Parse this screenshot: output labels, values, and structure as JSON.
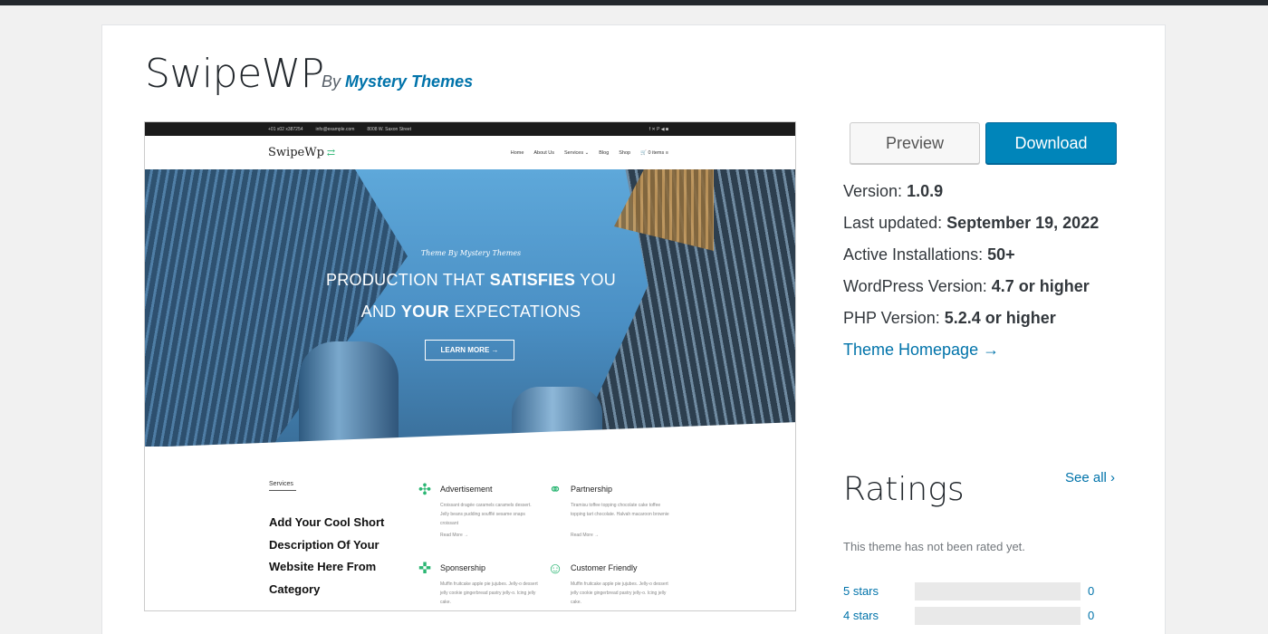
{
  "theme": {
    "name": "SwipeWP",
    "by_label": "By",
    "author": "Mystery Themes"
  },
  "preview_shot": {
    "topbar": {
      "phone": "+01 x02 x387254",
      "email": "info@example.com",
      "address": "8008 W. Saxon Street",
      "social": "f  ✕  P  ◀  ◙"
    },
    "logo": "SwipeWp",
    "menu": [
      "Home",
      "About Us",
      "Services ⌄",
      "Blog",
      "Shop"
    ],
    "cart": "0 items",
    "hero": {
      "subtitle": "Theme By Mystery Themes",
      "line1_pre": "PRODUCTION THAT ",
      "line1_bold": "SATISFIES",
      "line1_post": " YOU",
      "line2_pre": "AND ",
      "line2_bold": "YOUR",
      "line2_post": " EXPECTATIONS",
      "button": "LEARN MORE →"
    },
    "services": {
      "label": "Services",
      "heading": "Add Your Cool Short Description Of Your Website Here From Category",
      "items": [
        {
          "title": "Advertisement",
          "desc": "Croissant dragée caramels caramels dessert. Jelly beans pudding soufflé sesame snaps croissant",
          "more": "Read More →"
        },
        {
          "title": "Partnership",
          "desc": "Tiramisu toffee topping chocolate cake toffee topping tart chocolate. Halvah macaroon brownie",
          "more": "Read More →"
        },
        {
          "title": "Sponsership",
          "desc": "Muffin fruitcake apple pie jujubes. Jelly-o dessert jelly cookie gingerbread pastry jelly-o. Icing jelly cake.",
          "more": ""
        },
        {
          "title": "Customer Friendly",
          "desc": "Muffin fruitcake apple pie jujubes. Jelly-o dessert jelly cookie gingerbread pastry jelly-o. Icing jelly cake.",
          "more": ""
        }
      ]
    }
  },
  "actions": {
    "preview": "Preview",
    "download": "Download"
  },
  "meta": {
    "version_label": "Version:",
    "version": "1.0.9",
    "updated_label": "Last updated:",
    "updated": "September 19, 2022",
    "installs_label": "Active Installations:",
    "installs": "50+",
    "wp_label": "WordPress Version:",
    "wp": "4.7 or higher",
    "php_label": "PHP Version:",
    "php": "5.2.4 or higher",
    "homepage": "Theme Homepage →"
  },
  "ratings": {
    "title": "Ratings",
    "see_all": "See all ›",
    "not_rated": "This theme has not been rated yet.",
    "rows": [
      {
        "label": "5 stars",
        "count": "0"
      },
      {
        "label": "4 stars",
        "count": "0"
      }
    ]
  }
}
